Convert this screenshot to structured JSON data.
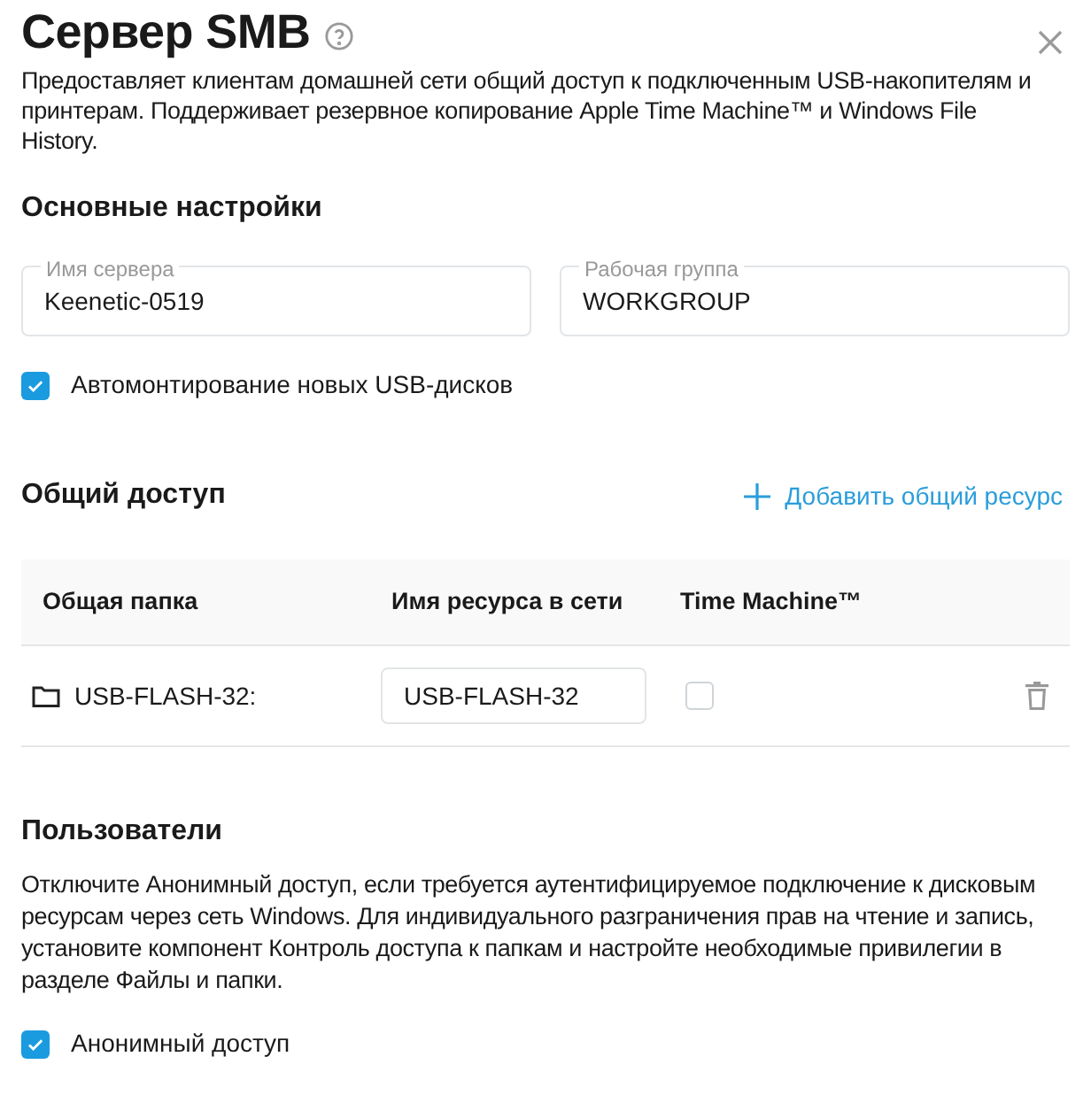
{
  "header": {
    "title": "Сервер SMB",
    "description": "Предоставляет клиентам домашней сети общий доступ к подключенным USB-накопителям и принтерам. Поддерживает резервное копирование Apple Time Machine™ и Windows File History."
  },
  "basic_settings": {
    "heading": "Основные настройки",
    "fields": [
      {
        "label": "Имя сервера",
        "value": "Keenetic-0519"
      },
      {
        "label": "Рабочая группа",
        "value": "WORKGROUP"
      }
    ],
    "automount": {
      "label": "Автомонтирование новых USB-дисков",
      "checked": true
    }
  },
  "sharing": {
    "heading": "Общий доступ",
    "add_button": "Добавить общий ресурс",
    "table": {
      "columns": [
        "Общая папка",
        "Имя ресурса в сети",
        "Time Machine™"
      ],
      "rows": [
        {
          "folder": "USB-FLASH-32:",
          "share_name": "USB-FLASH-32",
          "time_machine": false
        }
      ]
    }
  },
  "users": {
    "heading": "Пользователи",
    "description": "Отключите Анонимный доступ, если требуется аутентифицируемое подключение к дисковым ресурсам через сеть Windows. Для индивидуального разграничения прав на чтение и запись, установите компонент Контроль доступа к папкам и настройте необходимые привилегии в разделе Файлы и папки.",
    "anonymous": {
      "label": "Анонимный доступ",
      "checked": true
    }
  }
}
